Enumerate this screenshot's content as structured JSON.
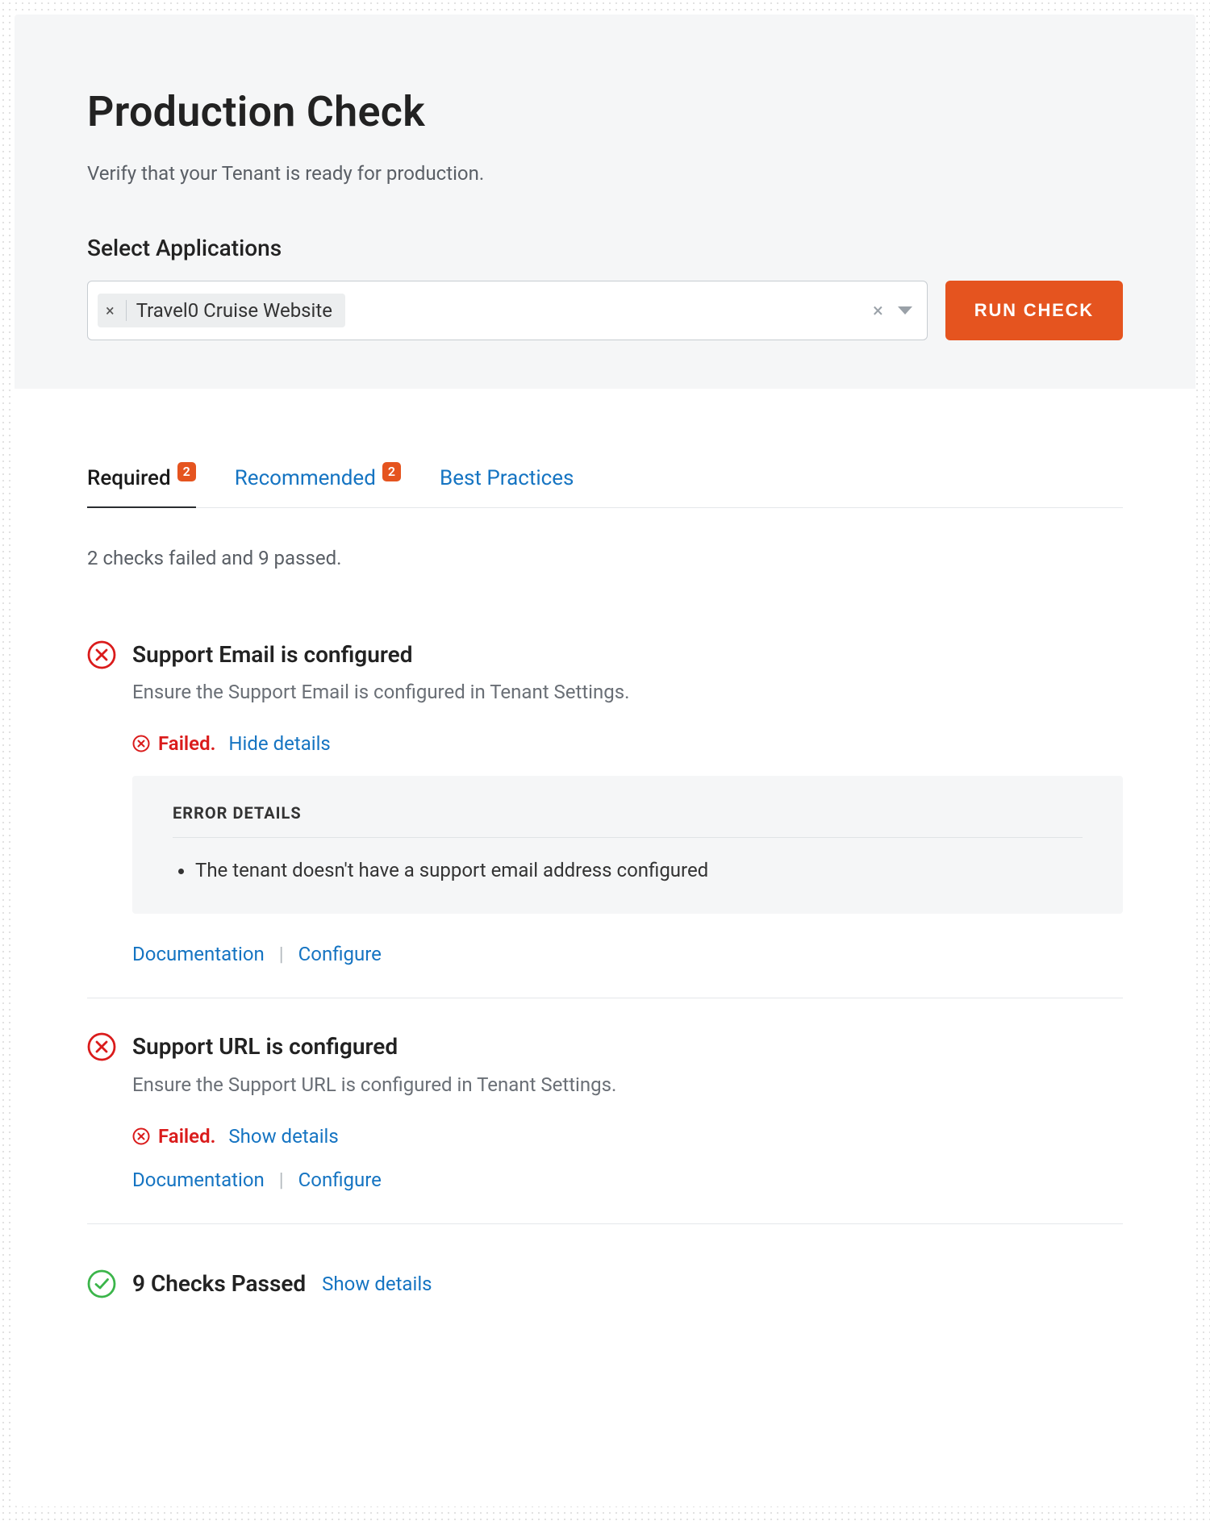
{
  "header": {
    "title": "Production Check",
    "subtitle": "Verify that your Tenant is ready for production.",
    "select_label": "Select Applications",
    "selected_chip": "Travel0 Cruise Website",
    "run_button": "RUN CHECK"
  },
  "tabs": {
    "required": {
      "label": "Required",
      "badge": "2"
    },
    "recommended": {
      "label": "Recommended",
      "badge": "2"
    },
    "best_practices": {
      "label": "Best Practices"
    }
  },
  "summary": "2 checks failed and 9 passed.",
  "checks": {
    "support_email": {
      "title": "Support Email is configured",
      "desc": "Ensure the Support Email is configured in Tenant Settings.",
      "status": "Failed.",
      "toggle": "Hide details",
      "error_header": "ERROR DETAILS",
      "error_item": "The tenant doesn't have a support email address configured",
      "doc_link": "Documentation",
      "configure_link": "Configure"
    },
    "support_url": {
      "title": "Support URL is configured",
      "desc": "Ensure the Support URL is configured in Tenant Settings.",
      "status": "Failed.",
      "toggle": "Show details",
      "doc_link": "Documentation",
      "configure_link": "Configure"
    }
  },
  "passed": {
    "title": "9 Checks Passed",
    "toggle": "Show details"
  }
}
